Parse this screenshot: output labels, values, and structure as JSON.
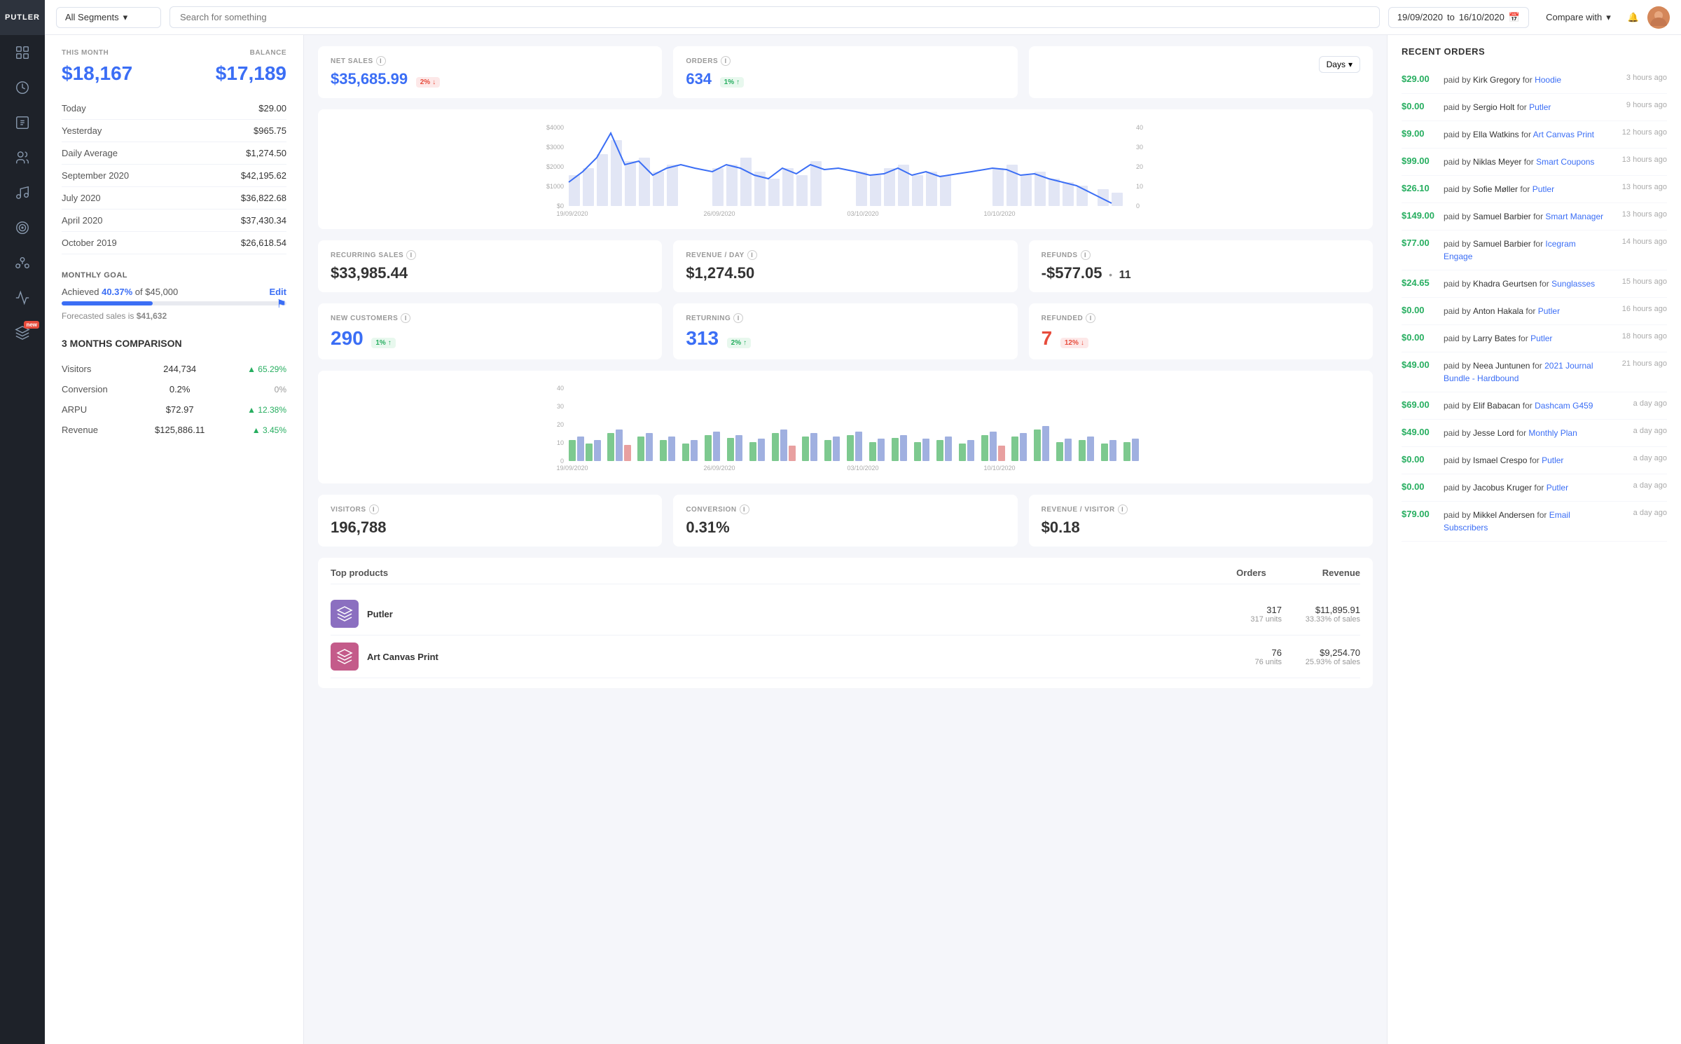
{
  "app": {
    "name": "PUTLER"
  },
  "topbar": {
    "segment": "All Segments",
    "search_placeholder": "Search for something",
    "date_from": "19/09/2020",
    "date_to": "16/10/2020",
    "compare_label": "Compare with"
  },
  "left": {
    "this_month_label": "THIS MONTH",
    "balance_label": "BALANCE",
    "this_month_value": "$18,167",
    "balance_value": "$17,189",
    "stats": [
      {
        "label": "Today",
        "value": "$29.00"
      },
      {
        "label": "Yesterday",
        "value": "$965.75"
      },
      {
        "label": "Daily Average",
        "value": "$1,274.50"
      },
      {
        "label": "September 2020",
        "value": "$42,195.62"
      },
      {
        "label": "July 2020",
        "value": "$36,822.68"
      },
      {
        "label": "April 2020",
        "value": "$37,430.34"
      },
      {
        "label": "October 2019",
        "value": "$26,618.54"
      }
    ],
    "monthly_goal": {
      "title": "MONTHLY GOAL",
      "achieved_pct": "40.37%",
      "achieved_of": "$45,000",
      "edit_label": "Edit",
      "forecasted_label": "Forecasted sales is",
      "forecasted_value": "$41,632"
    },
    "comparison": {
      "title": "3 MONTHS COMPARISON",
      "rows": [
        {
          "label": "Visitors",
          "value": "244,734",
          "change": "65.29%",
          "positive": true
        },
        {
          "label": "Conversion",
          "value": "0.2%",
          "change": "0%",
          "positive": null
        },
        {
          "label": "ARPU",
          "value": "$72.97",
          "change": "12.38%",
          "positive": true
        },
        {
          "label": "Revenue",
          "value": "$125,886.11",
          "change": "3.45%",
          "positive": true
        }
      ]
    }
  },
  "middle": {
    "kpi1": {
      "net_sales_label": "NET SALES",
      "net_sales_value": "$35,685.99",
      "net_sales_badge": "2%",
      "net_sales_badge_dir": "down",
      "orders_label": "ORDERS",
      "orders_value": "634",
      "orders_badge": "1%",
      "orders_badge_dir": "up",
      "days_btn": "Days"
    },
    "chart_dates": [
      "19/09/2020",
      "26/09/2020",
      "03/10/2020",
      "10/10/2020"
    ],
    "chart_y": [
      "$4000",
      "$3000",
      "$2000",
      "$1000",
      "$0"
    ],
    "chart_y2": [
      "40",
      "30",
      "20",
      "10",
      "0"
    ],
    "kpi2": {
      "recurring_label": "RECURRING SALES",
      "recurring_value": "$33,985.44",
      "revenue_day_label": "REVENUE / DAY",
      "revenue_day_value": "$1,274.50",
      "refunds_label": "REFUNDS",
      "refunds_value": "-$577.05",
      "refunds_count": "11"
    },
    "kpi3": {
      "new_customers_label": "NEW CUSTOMERS",
      "new_customers_value": "290",
      "new_customers_badge": "1%",
      "new_customers_badge_dir": "up",
      "returning_label": "RETURNING",
      "returning_value": "313",
      "returning_badge": "2%",
      "returning_badge_dir": "up",
      "refunded_label": "REFUNDED",
      "refunded_value": "7",
      "refunded_badge": "12%",
      "refunded_badge_dir": "down"
    },
    "kpi4": {
      "visitors_label": "VISITORS",
      "visitors_value": "196,788",
      "conversion_label": "CONVERSION",
      "conversion_value": "0.31%",
      "revenue_visitor_label": "REVENUE / VISITOR",
      "revenue_visitor_value": "$0.18"
    },
    "top_products": {
      "title": "Top products",
      "orders_col": "Orders",
      "revenue_col": "Revenue",
      "items": [
        {
          "name": "Putler",
          "orders": "317",
          "units": "317 units",
          "revenue": "$11,895.91",
          "sales_pct": "33.33% of sales",
          "color": "#8b6fc0"
        },
        {
          "name": "Art Canvas Print",
          "orders": "76",
          "units": "76 units",
          "revenue": "$9,254.70",
          "sales_pct": "25.93% of sales",
          "color": "#c45b8a"
        }
      ]
    }
  },
  "right": {
    "title": "RECENT ORDERS",
    "orders": [
      {
        "amount": "$29.00",
        "person": "Kirk Gregory",
        "product": "Hoodie",
        "time": "3 hours ago"
      },
      {
        "amount": "$0.00",
        "person": "Sergio Holt",
        "product": "Putler",
        "time": "9 hours ago"
      },
      {
        "amount": "$9.00",
        "person": "Ella Watkins",
        "product": "Art Canvas Print",
        "time": "12 hours ago"
      },
      {
        "amount": "$99.00",
        "person": "Niklas Meyer",
        "product": "Smart Coupons",
        "time": "13 hours ago"
      },
      {
        "amount": "$26.10",
        "person": "Sofie Møller",
        "product": "Putler",
        "time": "13 hours ago"
      },
      {
        "amount": "$149.00",
        "person": "Samuel Barbier",
        "product": "Smart Manager",
        "time": "13 hours ago"
      },
      {
        "amount": "$77.00",
        "person": "Samuel Barbier",
        "product": "Icegram Engage",
        "time": "14 hours ago"
      },
      {
        "amount": "$24.65",
        "person": "Khadra Geurtsen",
        "product": "Sunglasses",
        "time": "15 hours ago"
      },
      {
        "amount": "$0.00",
        "person": "Anton Hakala",
        "product": "Putler",
        "time": "16 hours ago"
      },
      {
        "amount": "$0.00",
        "person": "Larry Bates",
        "product": "Putler",
        "time": "18 hours ago"
      },
      {
        "amount": "$49.00",
        "person": "Neea Juntunen",
        "product": "2021 Journal Bundle - Hardbound",
        "time": "21 hours ago"
      },
      {
        "amount": "$69.00",
        "person": "Elif Babacan",
        "product": "Dashcam G459",
        "time": "a day ago"
      },
      {
        "amount": "$49.00",
        "person": "Jesse Lord",
        "product": "Monthly Plan",
        "time": "a day ago"
      },
      {
        "amount": "$0.00",
        "person": "Ismael Crespo",
        "product": "Putler",
        "time": "a day ago"
      },
      {
        "amount": "$0.00",
        "person": "Jacobus Kruger",
        "product": "Putler",
        "time": "a day ago"
      },
      {
        "amount": "$79.00",
        "person": "Mikkel Andersen",
        "product": "Email Subscribers",
        "time": "a day ago"
      }
    ]
  }
}
